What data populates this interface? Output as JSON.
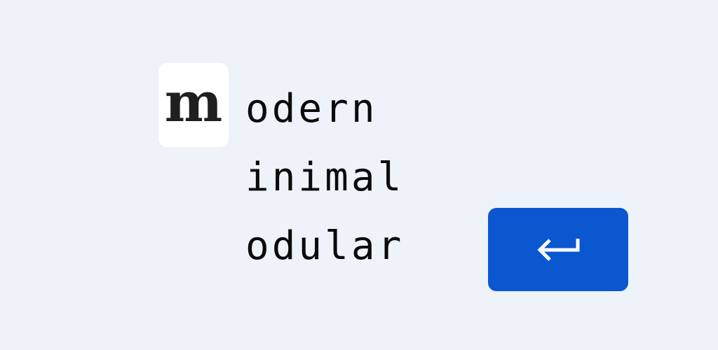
{
  "logo": {
    "letter": "m",
    "icon": "m-letter-logo-icon"
  },
  "words": [
    "odern",
    "inimal",
    "odular"
  ],
  "enter_button": {
    "icon": "enter-arrow-icon",
    "color": "#0b57d0"
  },
  "colors": {
    "background": "#eef3fa",
    "tile": "#ffffff",
    "text": "#0b0b0b",
    "accent": "#0b57d0"
  }
}
